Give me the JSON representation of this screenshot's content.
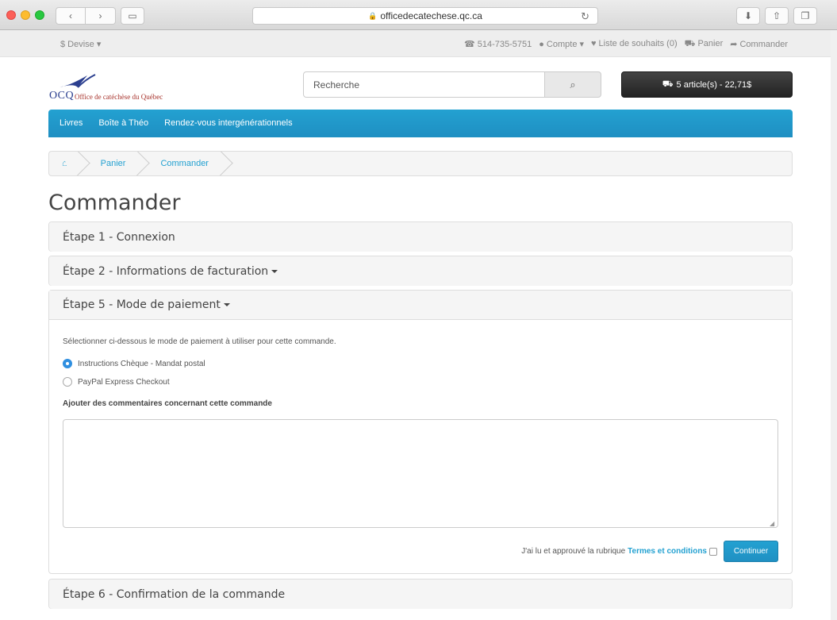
{
  "browser": {
    "url": "officedecatechese.qc.ca"
  },
  "topbar": {
    "currency": "$ Devise ▾",
    "phone": "514-735-5751",
    "account": "Compte ▾",
    "wishlist": "Liste de souhaits (0)",
    "cart": "Panier",
    "checkout": "Commander"
  },
  "logo": {
    "abbr": "OCQ",
    "name": "Office de catéchèse du Québec"
  },
  "search": {
    "placeholder": "Recherche"
  },
  "cart_button": {
    "label": "5 article(s) - 22,71$"
  },
  "nav": {
    "items": [
      "Livres",
      "Boîte à Théo",
      "Rendez-vous intergénérationnels"
    ]
  },
  "breadcrumb": {
    "items": [
      "Panier",
      "Commander"
    ]
  },
  "page": {
    "title": "Commander"
  },
  "steps": {
    "step1": "Étape 1 - Connexion",
    "step2": "Étape 2 - Informations de facturation",
    "step5": "Étape 5 - Mode de paiement",
    "step6": "Étape 6 - Confirmation de la commande"
  },
  "payment": {
    "intro": "Sélectionner ci-dessous le mode de paiement à utiliser pour cette commande.",
    "options": [
      {
        "label": "Instructions Chèque - Mandat postal",
        "selected": true
      },
      {
        "label": "PayPal Express Checkout",
        "selected": false
      }
    ],
    "comment_label": "Ajouter des commentaires concernant cette commande",
    "comment_value": "",
    "terms_prefix": "J'ai lu et approuvé la rubrique",
    "terms_link": "Termes et conditions",
    "terms_checked": false,
    "continue_label": "Continuer"
  },
  "colors": {
    "accent": "#229ac8",
    "cart_bg": "#363636"
  }
}
